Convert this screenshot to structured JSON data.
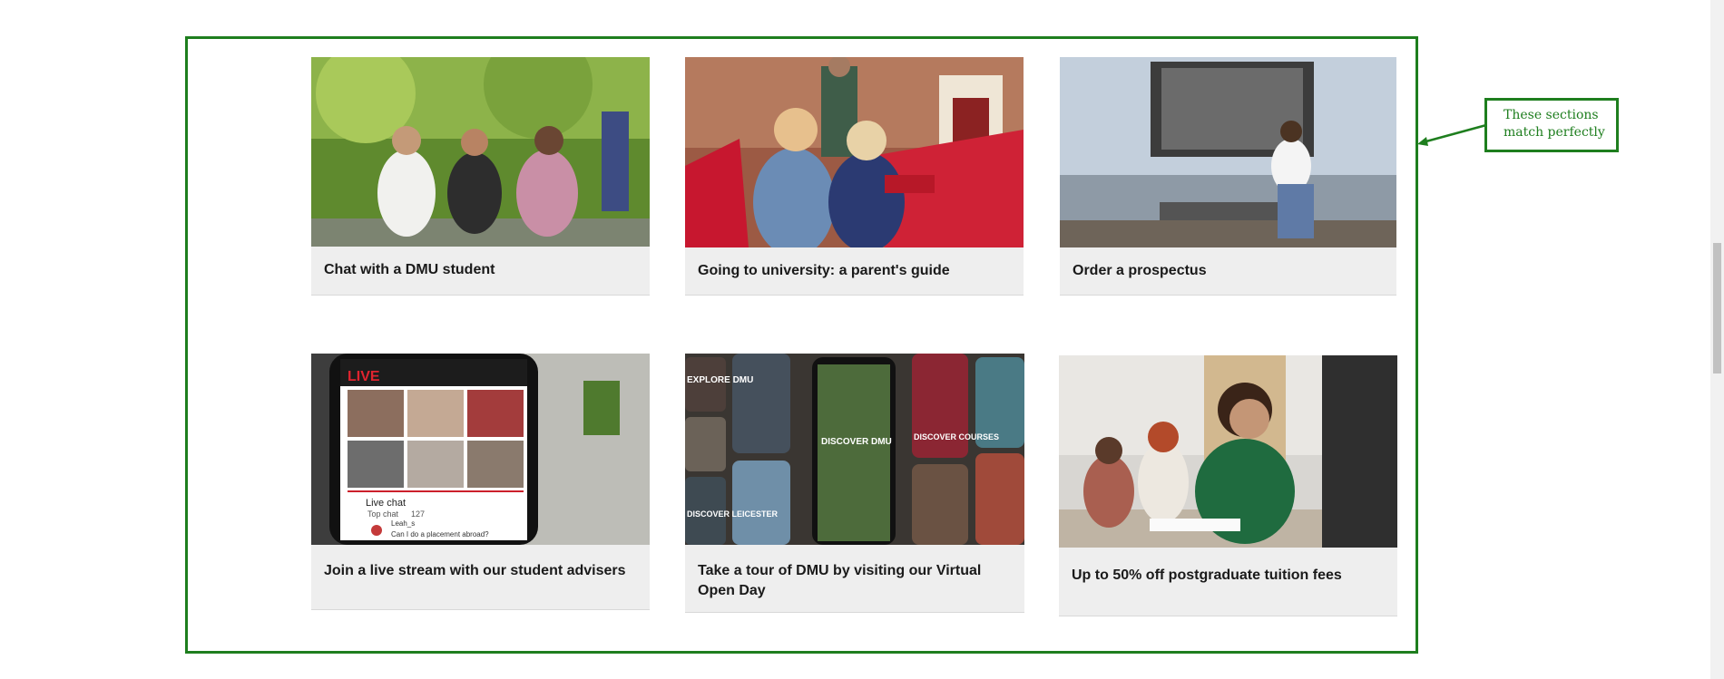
{
  "annotation": {
    "callout_text": "These sections match perfectly",
    "frame_color": "#1e7e1e"
  },
  "cards": [
    {
      "title": "Chat with a DMU student",
      "image_icon": "students-sitting-outdoors-photo"
    },
    {
      "title": "Going to university: a parent's guide",
      "image_icon": "parent-and-student-deckchairs-photo"
    },
    {
      "title": "Order a prospectus",
      "image_icon": "student-campus-screen-photo"
    },
    {
      "title": "Join a live stream with our student advisers",
      "image_icon": "phone-live-stream-photo"
    },
    {
      "title": "Take a tour of DMU by visiting our Virtual Open Day",
      "image_icon": "virtual-open-day-phones-photo"
    },
    {
      "title": "Up to 50% off postgraduate tuition fees",
      "image_icon": "postgraduate-lecture-photo"
    }
  ],
  "phone_screen": {
    "live_label": "LIVE",
    "live_chat_label": "Live chat",
    "top_chat_label": "Top chat",
    "viewer_count": "127",
    "chat_author": "Leah_s",
    "chat_message": "Can I do a placement abroad?"
  },
  "tour_screens": {
    "explore_dmu": "EXPLORE DMU",
    "discover_dmu": "DISCOVER DMU",
    "discover_courses": "DISCOVER COURSES",
    "discover_leicester": "DISCOVER LEICESTER"
  }
}
